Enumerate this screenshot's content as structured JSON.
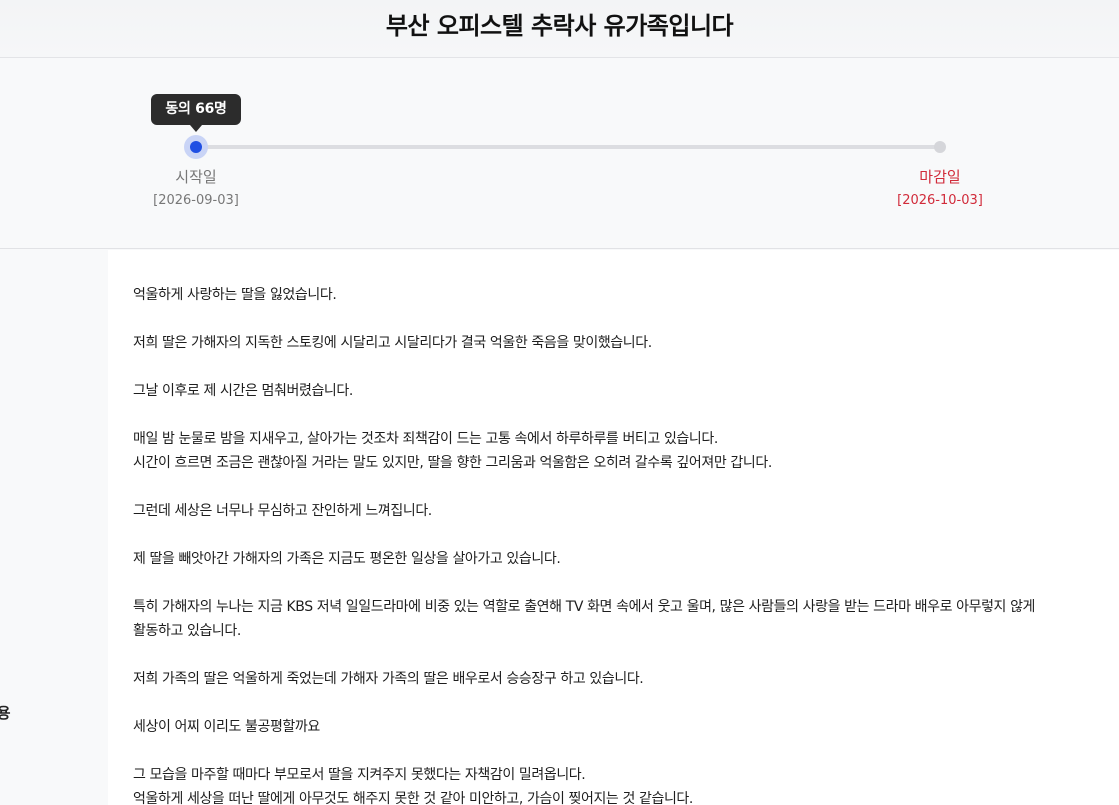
{
  "header": {
    "title": "부산 오피스텔 추락사 유가족입니다"
  },
  "timeline": {
    "tooltip": "동의 66명",
    "start_label": "시작일",
    "start_date": "[2026-09-03]",
    "end_label": "마감일",
    "end_date": "[2026-10-03]",
    "colors": {
      "progress_dot": "#1f4fe3",
      "deadline": "#d12b3a"
    }
  },
  "sidebar": {
    "cut_label": "내용"
  },
  "content": {
    "paragraphs": [
      [
        "억울하게 사랑하는 딸을 잃었습니다."
      ],
      [
        "저희 딸은 가해자의 지독한 스토킹에 시달리고 시달리다가 결국 억울한 죽음을 맞이했습니다."
      ],
      [
        "그날 이후로 제 시간은 멈춰버렸습니다."
      ],
      [
        "매일 밤 눈물로 밤을 지새우고, 살아가는 것조차 죄책감이 드는 고통 속에서 하루하루를 버티고 있습니다.",
        "시간이 흐르면 조금은 괜찮아질 거라는 말도 있지만, 딸을 향한 그리움과 억울함은 오히려 갈수록 깊어져만 갑니다."
      ],
      [
        "그런데 세상은 너무나 무심하고 잔인하게 느껴집니다."
      ],
      [
        "제 딸을 빼앗아간 가해자의 가족은 지금도 평온한 일상을 살아가고 있습니다."
      ],
      [
        "특히 가해자의 누나는 지금 KBS 저녁 일일드라마에 비중 있는 역할로 출연해 TV 화면 속에서 웃고 울며, 많은 사람들의 사랑을 받는 드라마 배우로 아무렇지 않게",
        "활동하고 있습니다."
      ],
      [
        "저희 가족의 딸은 억울하게 죽었는데 가해자 가족의 딸은 배우로서 승승장구 하고 있습니다."
      ],
      [
        "세상이 어찌 이리도 불공평할까요"
      ],
      [
        "그 모습을 마주할 때마다 부모로서 딸을 지켜주지 못했다는 자책감이 밀려옵니다.",
        "억울하게 세상을 떠난 딸에게 아무것도 해주지 못한 것 같아 미안하고, 가슴이 찢어지는 것 같습니다."
      ]
    ]
  }
}
